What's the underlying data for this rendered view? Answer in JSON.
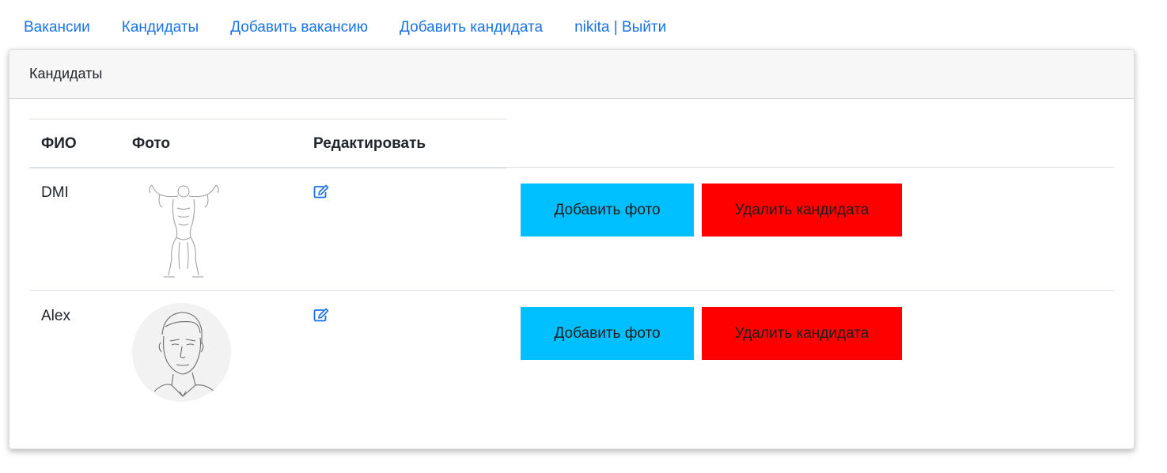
{
  "nav": {
    "items": [
      {
        "label": "Вакансии"
      },
      {
        "label": "Кандидаты"
      },
      {
        "label": "Добавить вакансию"
      },
      {
        "label": "Добавить кандидата"
      },
      {
        "label": "nikita | Выйти"
      }
    ]
  },
  "card": {
    "title": "Кандидаты"
  },
  "table": {
    "headers": {
      "name": "ФИО",
      "photo": "Фото",
      "edit": "Редактировать"
    },
    "rows": [
      {
        "name": "DMI",
        "add_photo_label": "Добавить фото",
        "delete_label": "Удалить кандидата"
      },
      {
        "name": "Alex",
        "add_photo_label": "Добавить фото",
        "delete_label": "Удалить кандидата"
      }
    ]
  },
  "colors": {
    "link": "#1a73e8",
    "add_photo_button": "#00bfff",
    "delete_button": "#ff0000"
  },
  "icons": {
    "edit": "edit-icon",
    "photo_row1": "bodybuilder-sketch",
    "photo_row2": "face-sketch"
  }
}
